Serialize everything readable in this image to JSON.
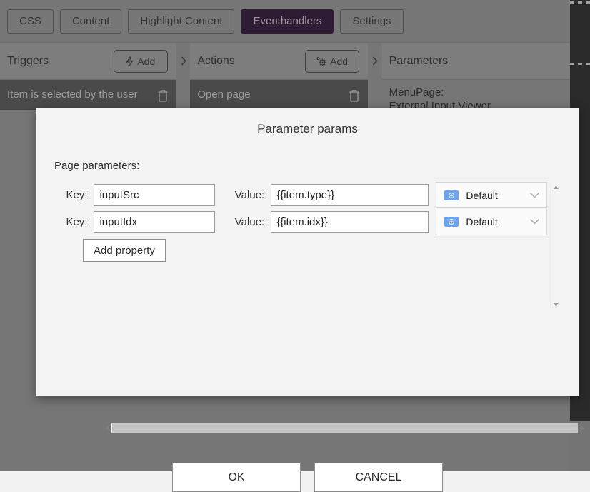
{
  "tabs": [
    {
      "label": "CSS",
      "active": false
    },
    {
      "label": "Content",
      "active": false
    },
    {
      "label": "Highlight Content",
      "active": false
    },
    {
      "label": "Eventhandlers",
      "active": true
    },
    {
      "label": "Settings",
      "active": false
    }
  ],
  "columns": {
    "triggers": {
      "title": "Triggers",
      "add_label": "Add",
      "add_icon": "lightning-bolt-icon",
      "items": [
        {
          "label": "Item is selected by the user",
          "delete_icon": "trash-icon"
        }
      ]
    },
    "actions": {
      "title": "Actions",
      "add_label": "Add",
      "add_icon": "gear-icon",
      "items": [
        {
          "label": "Open page",
          "delete_icon": "trash-icon"
        }
      ]
    },
    "parameters": {
      "title": "Parameters",
      "detail_line_1": "MenuPage:",
      "detail_line_2": "External Input Viewer"
    },
    "separator_icon": "chevron-right-icon"
  },
  "dialog": {
    "title": "Parameter params",
    "section_label": "Page parameters:",
    "key_label": "Key:",
    "value_label": "Value:",
    "rows": [
      {
        "key": "inputSrc",
        "value": "{{item.type}}",
        "locale": "Default",
        "locale_icon": "flag-icon"
      },
      {
        "key": "inputIdx",
        "value": "{{item.idx}}",
        "locale": "Default",
        "locale_icon": "flag-icon"
      }
    ],
    "add_property_label": "Add property",
    "ok_label": "OK",
    "cancel_label": "CANCEL",
    "scroll": {
      "up_icon": "triangle-up-icon",
      "down_icon": "triangle-down-icon",
      "left_icon": "triangle-left-icon",
      "right_icon": "triangle-right-icon"
    }
  },
  "colors": {
    "accent_active_tab": "#32163a",
    "editor_background": "#969696",
    "dialog_background": "#f3f3f3",
    "row_background": "#5a5a5a",
    "locale_flag": "#6ba4f0"
  }
}
